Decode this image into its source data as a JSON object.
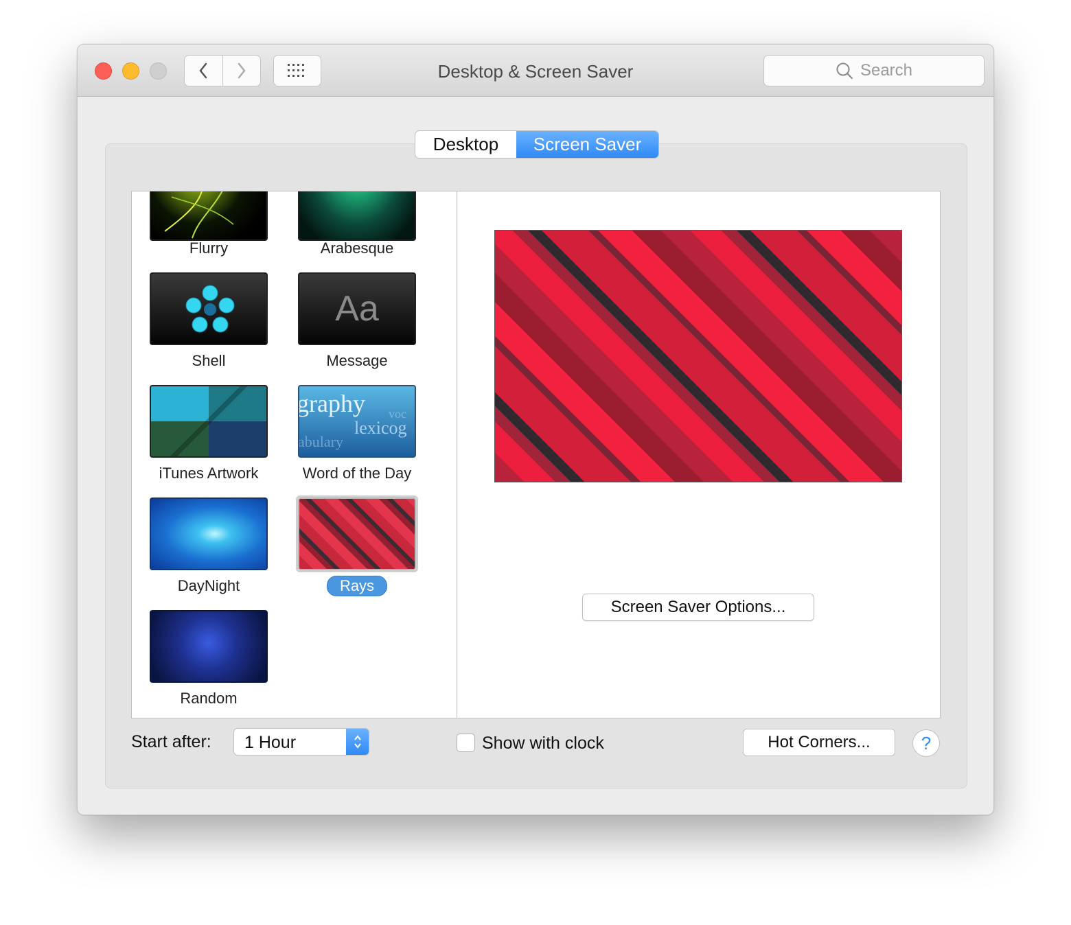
{
  "window": {
    "title": "Desktop & Screen Saver",
    "search_placeholder": "Search"
  },
  "tabs": [
    {
      "label": "Desktop",
      "selected": false
    },
    {
      "label": "Screen Saver",
      "selected": true
    }
  ],
  "savers": [
    {
      "name": "Flurry",
      "selected": false
    },
    {
      "name": "Arabesque",
      "selected": false
    },
    {
      "name": "Shell",
      "selected": false
    },
    {
      "name": "Message",
      "selected": false,
      "thumb_text": "Aa"
    },
    {
      "name": "iTunes Artwork",
      "selected": false
    },
    {
      "name": "Word of the Day",
      "selected": false,
      "thumb_words": [
        "graphy",
        "voc",
        "lexicog",
        "abulary"
      ]
    },
    {
      "name": "DayNight",
      "selected": false
    },
    {
      "name": "Rays",
      "selected": true
    },
    {
      "name": "Random",
      "selected": false
    }
  ],
  "preview": {
    "options_label": "Screen Saver Options..."
  },
  "footer": {
    "start_after_label": "Start after:",
    "start_after_value": "1 Hour",
    "show_clock_label": "Show with clock",
    "show_clock_checked": false,
    "hot_corners_label": "Hot Corners...",
    "help_label": "?"
  },
  "colors": {
    "accent": "#2f89f5",
    "close": "#fc5f57",
    "minimize": "#fdbc2e",
    "zoom_disabled": "#cfcfcf"
  }
}
